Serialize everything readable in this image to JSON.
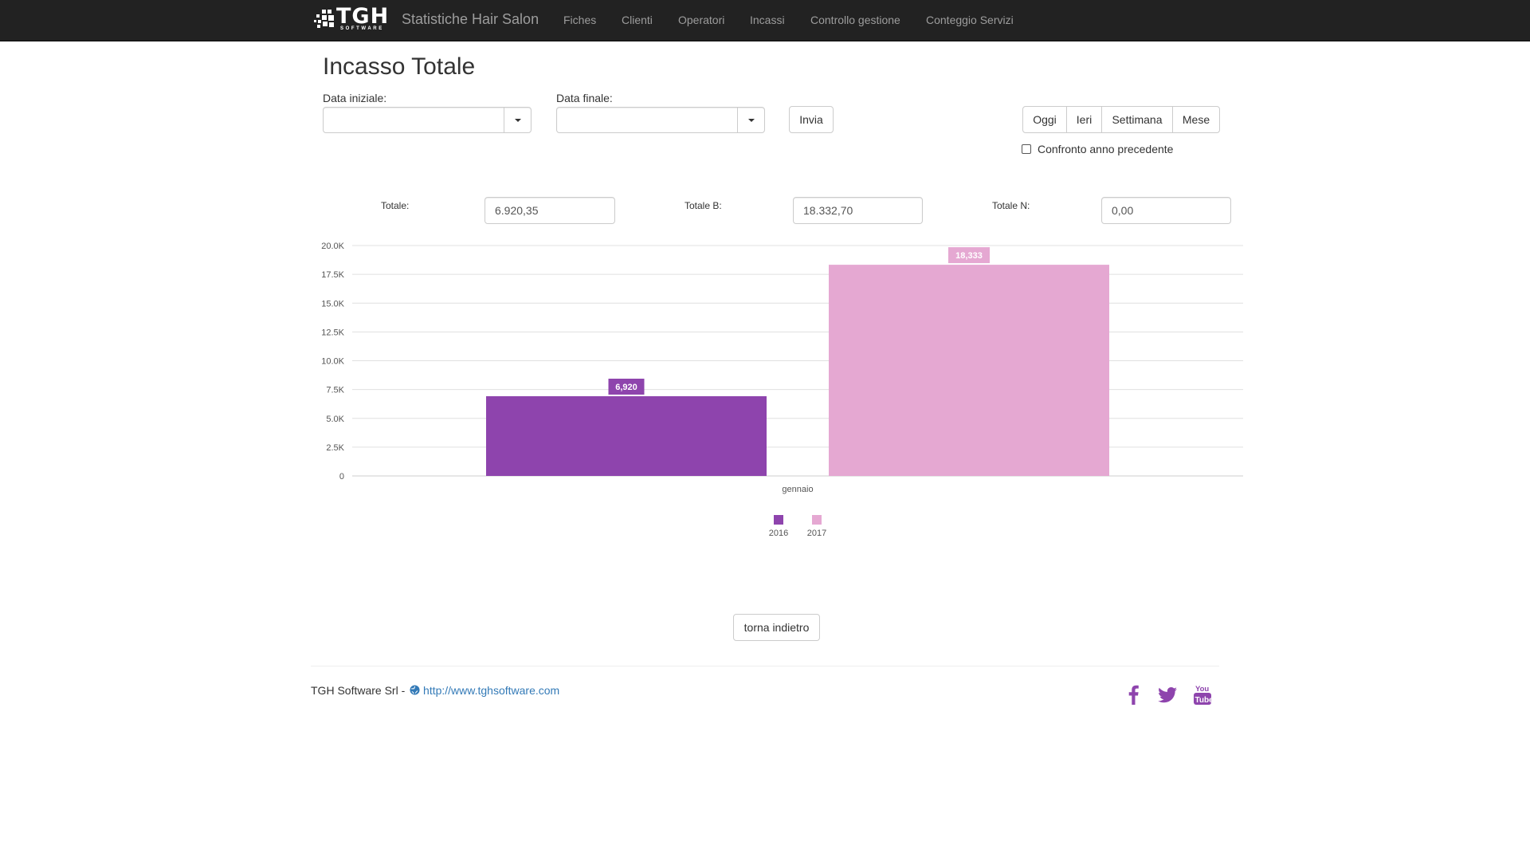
{
  "navbar": {
    "logo_text": "TGH",
    "logo_sub": "SOFTWARE",
    "brand_title": "Statistiche Hair Salon",
    "items": [
      "Fiches",
      "Clienti",
      "Operatori",
      "Incassi",
      "Controllo gestione",
      "Conteggio Servizi"
    ]
  },
  "page": {
    "title": "Incasso Totale",
    "start_label": "Data iniziale:",
    "start_value": "",
    "end_label": "Data finale:",
    "end_value": "",
    "submit_label": "Invia",
    "quick_ranges": [
      "Oggi",
      "Ieri",
      "Settimana",
      "Mese"
    ],
    "compare_label": "Confronto anno precedente",
    "compare_checked": false
  },
  "totals": {
    "totale_label": "Totale:",
    "totale_value": "6.920,35",
    "totale_b_label": "Totale B:",
    "totale_b_value": "18.332,70",
    "totale_n_label": "Totale N:",
    "totale_n_value": "0,00"
  },
  "chart_data": {
    "type": "bar",
    "categories": [
      "gennaio"
    ],
    "series": [
      {
        "name": "2016",
        "values": [
          6920.35
        ],
        "label": "6,920",
        "color": "#8e44ad"
      },
      {
        "name": "2017",
        "values": [
          18332.7
        ],
        "label": "18,333",
        "color": "#e5a8d2"
      }
    ],
    "ylim": [
      0,
      20000
    ],
    "yticks": [
      "0",
      "2.5K",
      "5.0K",
      "7.5K",
      "10.0K",
      "12.5K",
      "15.0K",
      "17.5K",
      "20.0K"
    ],
    "ytick_values": [
      0,
      2500,
      5000,
      7500,
      10000,
      12500,
      15000,
      17500,
      20000
    ],
    "grid": true,
    "legend": "bottom"
  },
  "back_label": "torna indietro",
  "footer": {
    "company": "TGH Software Srl -",
    "url": "http://www.tghsoftware.com"
  },
  "social_icons": [
    "facebook-icon",
    "twitter-icon",
    "youtube-icon"
  ],
  "colors": {
    "navbar": "#222222",
    "nav_text": "#9d9d9d",
    "accent": "#8e44ad",
    "link": "#337ab7"
  }
}
